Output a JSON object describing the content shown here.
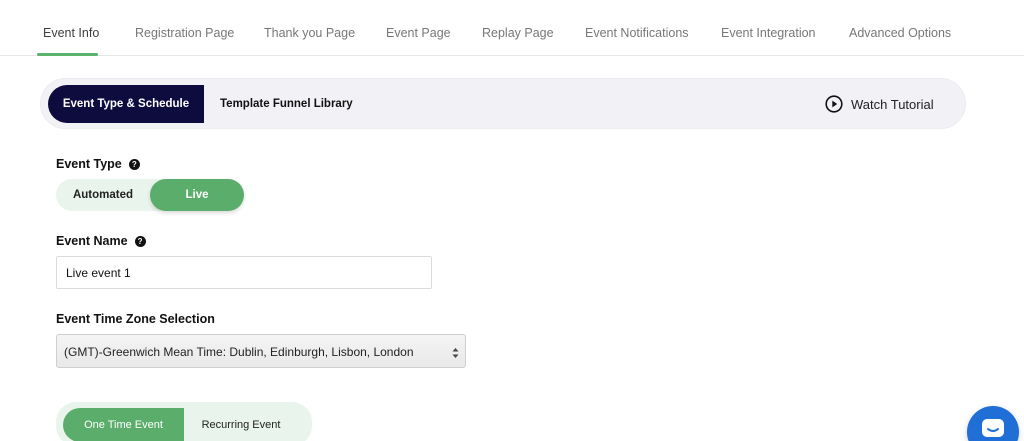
{
  "tabs": [
    {
      "label": "Event Info",
      "active": true
    },
    {
      "label": "Registration Page",
      "active": false
    },
    {
      "label": "Thank you Page",
      "active": false
    },
    {
      "label": "Event Page",
      "active": false
    },
    {
      "label": "Replay Page",
      "active": false
    },
    {
      "label": "Event Notifications",
      "active": false
    },
    {
      "label": "Event Integration",
      "active": false
    },
    {
      "label": "Advanced Options",
      "active": false
    }
  ],
  "subnav": {
    "active_label": "Event Type & Schedule",
    "second_label": "Template Funnel Library",
    "watch_label": "Watch Tutorial",
    "watch_icon": "play-circle-icon"
  },
  "event_type": {
    "label": "Event Type",
    "options": [
      "Automated",
      "Live"
    ],
    "selected": "Live"
  },
  "event_name": {
    "label": "Event Name",
    "value": "Live event 1"
  },
  "timezone": {
    "label": "Event Time Zone Selection",
    "selected": "(GMT)-Greenwich Mean Time: Dublin, Edinburgh, Lisbon, London"
  },
  "frequency": {
    "options": [
      "One Time Event",
      "Recurring Event"
    ],
    "selected": "One Time Event"
  },
  "colors": {
    "accent_green": "#5aad6a",
    "navy": "#0e0c3f",
    "chat_blue": "#1f6fd6"
  }
}
